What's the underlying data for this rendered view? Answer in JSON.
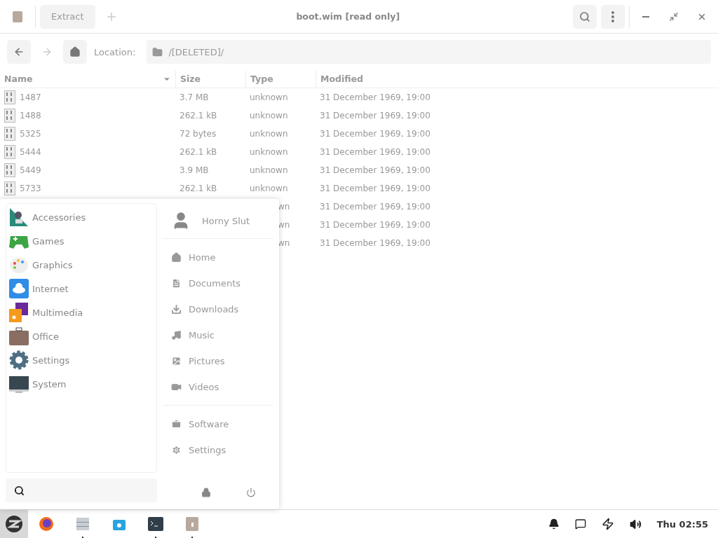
{
  "window": {
    "title": "boot.wim [read only]",
    "tab": "Extract"
  },
  "location": {
    "label": "Location:",
    "path": "/[DELETED]/"
  },
  "table": {
    "columns": [
      {
        "label": "Name",
        "sorted": true
      },
      {
        "label": "Size",
        "sorted": false
      },
      {
        "label": "Type",
        "sorted": false
      },
      {
        "label": "Modified",
        "sorted": false
      }
    ],
    "rows": [
      {
        "kind": "full",
        "name": "1487",
        "size": "3.7 MB",
        "type": "unknown",
        "modified": "31 December 1969, 19:00"
      },
      {
        "kind": "full",
        "name": "1488",
        "size": "262.1 kB",
        "type": "unknown",
        "modified": "31 December 1969, 19:00"
      },
      {
        "kind": "full",
        "name": "5325",
        "size": "72 bytes",
        "type": "unknown",
        "modified": "31 December 1969, 19:00"
      },
      {
        "kind": "full",
        "name": "5444",
        "size": "262.1 kB",
        "type": "unknown",
        "modified": "31 December 1969, 19:00"
      },
      {
        "kind": "full",
        "name": "5449",
        "size": "3.9 MB",
        "type": "unknown",
        "modified": "31 December 1969, 19:00"
      },
      {
        "kind": "full",
        "name": "5733",
        "size": "262.1 kB",
        "type": "unknown",
        "modified": "31 December 1969, 19:00"
      },
      {
        "kind": "covered",
        "type": "wn",
        "modified": "31 December 1969, 19:00"
      },
      {
        "kind": "covered",
        "type": "wn",
        "modified": "31 December 1969, 19:00"
      },
      {
        "kind": "covered",
        "type": "wn",
        "modified": "31 December 1969, 19:00"
      }
    ]
  },
  "menu": {
    "categories": [
      {
        "kind": "accessories",
        "label": "Accessories"
      },
      {
        "kind": "games",
        "label": "Games"
      },
      {
        "kind": "graphics",
        "label": "Graphics"
      },
      {
        "kind": "internet",
        "label": "Internet"
      },
      {
        "kind": "multimedia",
        "label": "Multimedia"
      },
      {
        "kind": "office",
        "label": "Office"
      },
      {
        "kind": "settings",
        "label": "Settings"
      },
      {
        "kind": "system",
        "label": "System"
      }
    ],
    "user": "Horny Slut",
    "places": [
      {
        "kind": "home",
        "label": "Home"
      },
      {
        "kind": "documents",
        "label": "Documents"
      },
      {
        "kind": "downloads",
        "label": "Downloads"
      },
      {
        "kind": "music",
        "label": "Music"
      },
      {
        "kind": "pictures",
        "label": "Pictures"
      },
      {
        "kind": "videos",
        "label": "Videos"
      }
    ],
    "system": [
      {
        "kind": "software",
        "label": "Software"
      },
      {
        "kind": "settings",
        "label": "Settings"
      }
    ]
  },
  "taskbar": {
    "apps": [
      {
        "kind": "browser",
        "running": false
      },
      {
        "kind": "files",
        "running": true
      },
      {
        "kind": "store",
        "running": false
      },
      {
        "kind": "terminal",
        "running": true
      },
      {
        "kind": "archive",
        "running": true
      }
    ],
    "clock": "Thu 02:55"
  }
}
